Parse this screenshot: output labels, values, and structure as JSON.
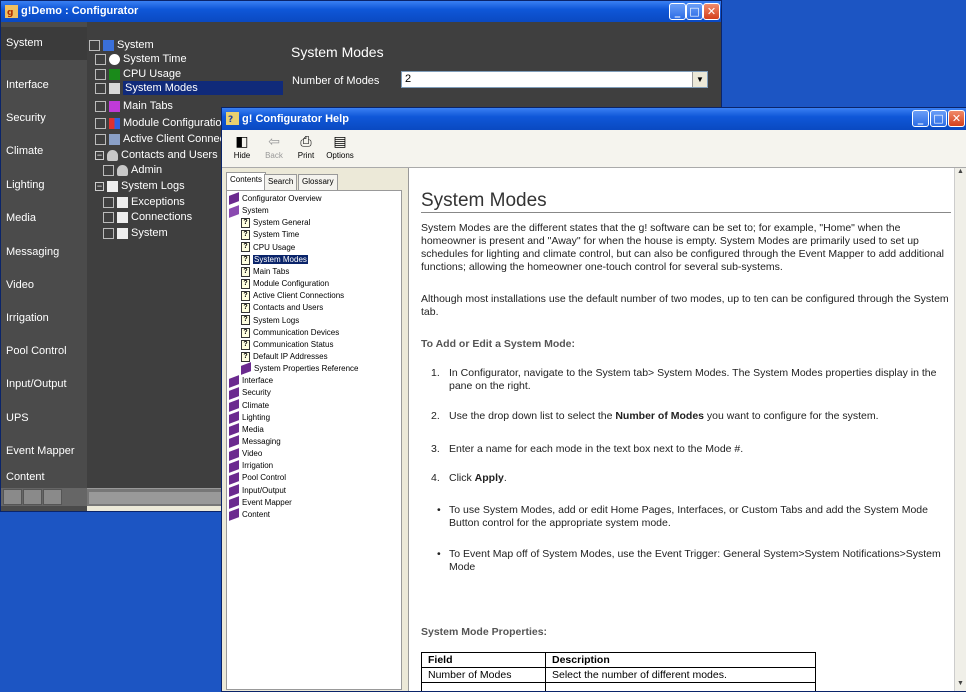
{
  "configurator": {
    "title": "g!Demo : Configurator",
    "nav_items": [
      "System",
      "Interface",
      "Security",
      "Climate",
      "Lighting",
      "Media",
      "Messaging",
      "Video",
      "Irrigation",
      "Pool Control",
      "Input/Output",
      "UPS",
      "Event Mapper",
      "Content"
    ],
    "tree": [
      {
        "label": "System",
        "icon": "monitor-icon"
      },
      {
        "label": "System Time",
        "icon": "clock-icon"
      },
      {
        "label": "CPU Usage",
        "icon": "cpu-usage-icon"
      },
      {
        "label": "System Modes",
        "icon": "system-modes-icon"
      },
      {
        "label": "Main Tabs",
        "icon": "main-tabs-icon"
      },
      {
        "label": "Module Configuration",
        "icon": "module-config-icon"
      },
      {
        "label": "Active Client Connectic",
        "icon": "client-connections-icon"
      },
      {
        "label": "Contacts and Users",
        "icon": "users-icon"
      },
      {
        "label": "Admin",
        "icon": "user-icon"
      },
      {
        "label": "System Logs",
        "icon": "logs-icon"
      },
      {
        "label": "Exceptions",
        "icon": "log-icon"
      },
      {
        "label": "Connections",
        "icon": "log-icon"
      },
      {
        "label": "System",
        "icon": "log-icon"
      }
    ],
    "content_title": "System Modes",
    "num_modes_label": "Number of Modes",
    "num_modes_value": "2"
  },
  "help": {
    "title": "g! Configurator Help",
    "toolbar": [
      "Hide",
      "Back",
      "Print",
      "Options"
    ],
    "tabs": [
      "Contents",
      "Search",
      "Glossary"
    ],
    "toc": [
      {
        "label": "Configurator Overview",
        "type": "book"
      },
      {
        "label": "System",
        "type": "book-open"
      },
      {
        "label": "System General",
        "type": "page"
      },
      {
        "label": "System Time",
        "type": "page"
      },
      {
        "label": "CPU Usage",
        "type": "page"
      },
      {
        "label": "System Modes",
        "type": "page"
      },
      {
        "label": "Main Tabs",
        "type": "page"
      },
      {
        "label": "Module Configuration",
        "type": "page"
      },
      {
        "label": "Active Client Connections",
        "type": "page"
      },
      {
        "label": "Contacts and Users",
        "type": "page"
      },
      {
        "label": "System Logs",
        "type": "page"
      },
      {
        "label": "Communication Devices",
        "type": "page"
      },
      {
        "label": "Communication Status",
        "type": "page"
      },
      {
        "label": "Default IP Addresses",
        "type": "page"
      },
      {
        "label": "System Properties Reference",
        "type": "book"
      },
      {
        "label": "Interface",
        "type": "book"
      },
      {
        "label": "Security",
        "type": "book"
      },
      {
        "label": "Climate",
        "type": "book"
      },
      {
        "label": "Lighting",
        "type": "book"
      },
      {
        "label": "Media",
        "type": "book"
      },
      {
        "label": "Messaging",
        "type": "book"
      },
      {
        "label": "Video",
        "type": "book"
      },
      {
        "label": "Irrigation",
        "type": "book"
      },
      {
        "label": "Pool Control",
        "type": "book"
      },
      {
        "label": "Input/Output",
        "type": "book"
      },
      {
        "label": "Event Mapper",
        "type": "book"
      },
      {
        "label": "Content",
        "type": "book"
      }
    ],
    "doc": {
      "heading": "System Modes",
      "p1": "System Modes are the different states that the g! software can be set to; for example, \"Home\" when the homeowner is present and \"Away\" for when the house is empty. System Modes are primarily used to set up schedules for lighting and climate control, but can also be configured through the Event Mapper to add additional functions; allowing the homeowner one-touch control for several sub-systems.",
      "p2": "Although most installations use the default number of two modes, up to ten can be configured through the System tab.",
      "h_add": "To Add or Edit a System Mode:",
      "step1": "In Configurator, navigate to the System tab> System Modes. The System Modes properties display in the pane on the right.",
      "step2_a": "Use the drop down list to select the ",
      "step2_b": "Number of Modes",
      "step2_c": " you want to configure for the system.",
      "step3": "Enter a name for each mode in the text box next to the Mode #.",
      "step4_a": "Click ",
      "step4_b": "Apply",
      "step4_c": ".",
      "bullet1": "To use System Modes, add or edit Home Pages, Interfaces, or Custom Tabs and add the System Mode Button control for the appropriate system mode.",
      "bullet2": "To Event Map off of System Modes, use the Event Trigger: General System>System Notifications>System Mode",
      "h_props": "System Mode Properties:",
      "table_headers": [
        "Field",
        "Description"
      ],
      "table_rows": [
        [
          "Number of Modes",
          "Select the number of different modes."
        ]
      ]
    }
  }
}
